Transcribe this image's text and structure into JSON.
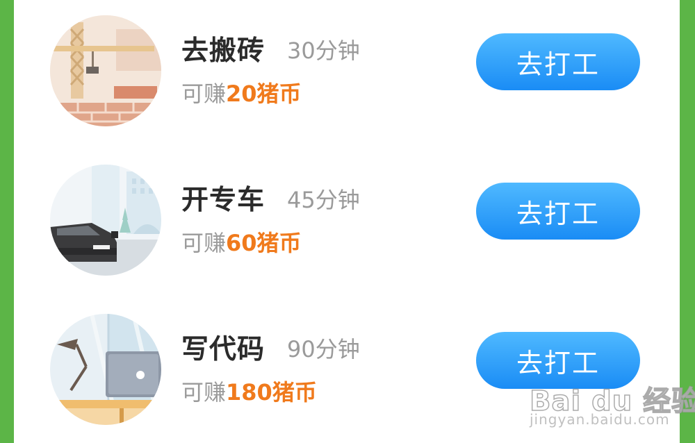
{
  "jobs": [
    {
      "name": "去搬砖",
      "duration": "30分钟",
      "earn_prefix": "可赚",
      "reward": "20猪币",
      "button_label": "去打工",
      "thumb_icon": "brick-crane-icon"
    },
    {
      "name": "开专车",
      "duration": "45分钟",
      "earn_prefix": "可赚",
      "reward": "60猪币",
      "button_label": "去打工",
      "thumb_icon": "car-city-icon"
    },
    {
      "name": "写代码",
      "duration": "90分钟",
      "earn_prefix": "可赚",
      "reward": "180猪币",
      "button_label": "去打工",
      "thumb_icon": "laptop-desk-icon"
    }
  ],
  "watermark": {
    "brand": "Bai du 经验",
    "url": "jingyan.baidu.com"
  },
  "colors": {
    "frame": "#5cb547",
    "reward": "#f07a1c",
    "button": "#2196f3"
  }
}
